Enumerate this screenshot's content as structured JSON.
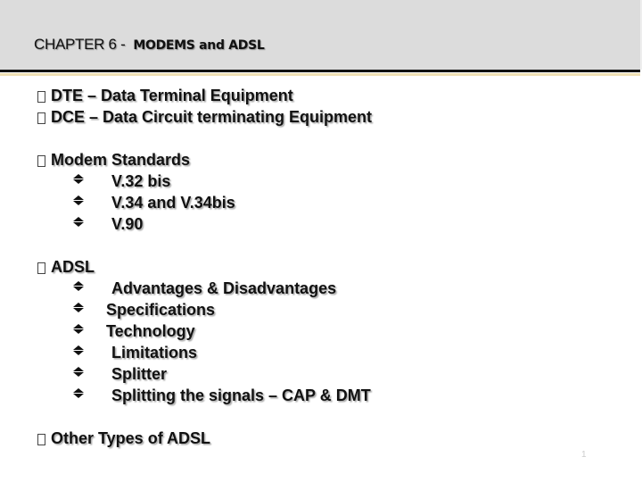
{
  "header": {
    "title_prefix": "CHAPTER 6 -  ",
    "title_main": "MODEMS and ADSL"
  },
  "colors": {
    "header_band": "#dcdcdc",
    "rule_dark": "#111111",
    "rule_gold": "#efe0b4",
    "text": "#111111"
  },
  "content": {
    "items": [
      {
        "label": "DTE – Data Terminal Equipment",
        "bullet": "missing-glyph-box"
      },
      {
        "label": "DCE – Data Circuit terminating Equipment",
        "bullet": "missing-glyph-box"
      },
      {
        "label": "Modem Standards",
        "bullet": "missing-glyph-box",
        "children": [
          "V.32 bis",
          "V.34 and V.34bis",
          "V.90"
        ]
      },
      {
        "label": "ADSL",
        "bullet": "missing-glyph-box",
        "children": [
          "Advantages & Disadvantages",
          "Specifications",
          "Technology",
          "Limitations",
          "Splitter",
          "Splitting the signals – CAP & DMT"
        ]
      },
      {
        "label": "Other Types of ADSL",
        "bullet": "missing-glyph-box"
      }
    ]
  },
  "footer": {
    "slide_number": "1"
  }
}
